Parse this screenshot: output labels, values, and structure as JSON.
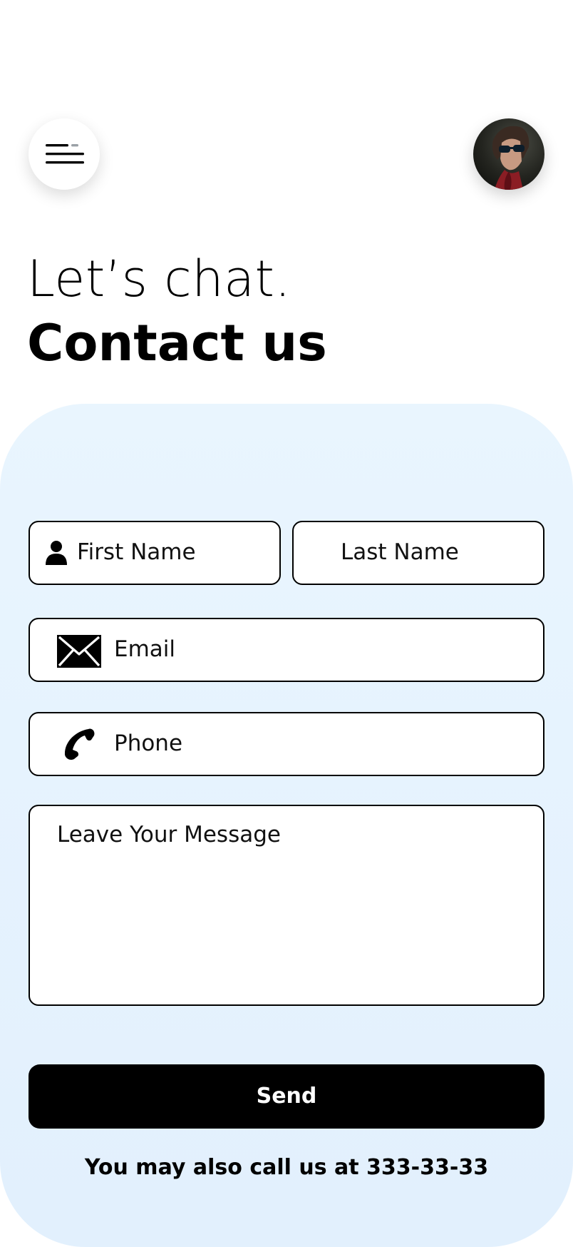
{
  "header": {
    "menu_icon": "hamburger-menu-icon",
    "avatar_icon": "user-avatar"
  },
  "heading": {
    "line1": "Let’s chat.",
    "line2": "Contact us"
  },
  "form": {
    "first_name": {
      "placeholder": "First Name",
      "icon": "person-icon"
    },
    "last_name": {
      "placeholder": "Last Name"
    },
    "email": {
      "placeholder": "Email",
      "icon": "envelope-icon"
    },
    "phone": {
      "placeholder": "Phone",
      "icon": "phone-icon"
    },
    "message": {
      "placeholder": "Leave Your Message"
    },
    "send_label": "Send"
  },
  "footer": {
    "call_note": "You may also call us at 333-33-33"
  },
  "colors": {
    "panel_background": "#e6f3fe",
    "button": "#000000",
    "button_text": "#ffffff",
    "field_border": "#000000"
  }
}
